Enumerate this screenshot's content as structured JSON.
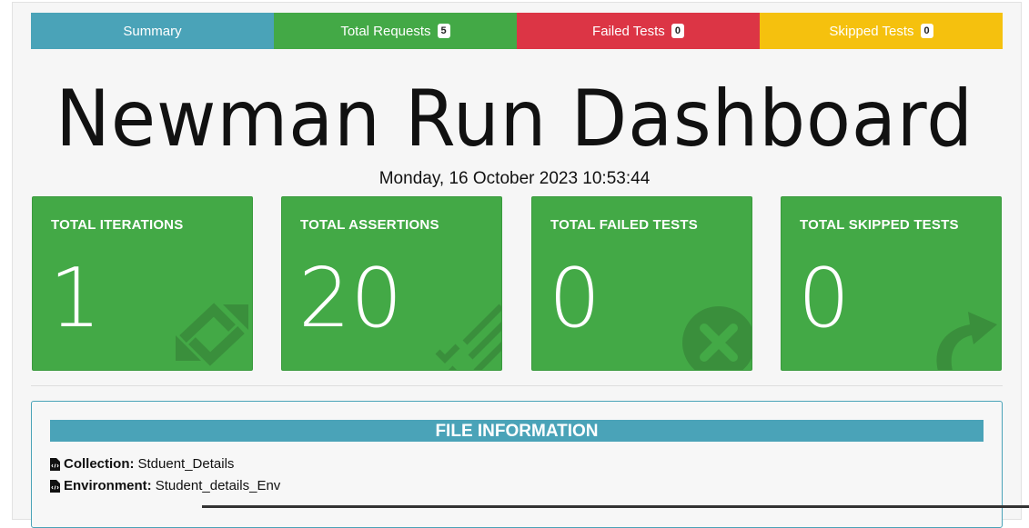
{
  "tabs": [
    {
      "label": "Summary",
      "badge": null,
      "color": "#4aa3b8"
    },
    {
      "label": "Total Requests",
      "badge": "5",
      "color": "#43a946"
    },
    {
      "label": "Failed Tests",
      "badge": "0",
      "color": "#dc3545"
    },
    {
      "label": "Skipped Tests",
      "badge": "0",
      "color": "#f5c10e"
    }
  ],
  "header": {
    "title": "Newman Run Dashboard",
    "timestamp": "Monday, 16 October 2023 10:53:44"
  },
  "cards": [
    {
      "label": "TOTAL ITERATIONS",
      "value": "1",
      "icon": "sync-arrows-icon"
    },
    {
      "label": "TOTAL ASSERTIONS",
      "value": "20",
      "icon": "checklist-icon"
    },
    {
      "label": "TOTAL FAILED TESTS",
      "value": "0",
      "icon": "times-circle-icon"
    },
    {
      "label": "TOTAL SKIPPED TESTS",
      "value": "0",
      "icon": "share-arrow-icon"
    }
  ],
  "file_info": {
    "title": "FILE INFORMATION",
    "collection_label": "Collection:",
    "collection_value": "Stduent_Details",
    "environment_label": "Environment:",
    "environment_value": "Student_details_Env"
  },
  "colors": {
    "card_green": "#43a946",
    "info_blue": "#4aa3b8",
    "danger_red": "#dc3545",
    "warning_yellow": "#f5c10e"
  }
}
